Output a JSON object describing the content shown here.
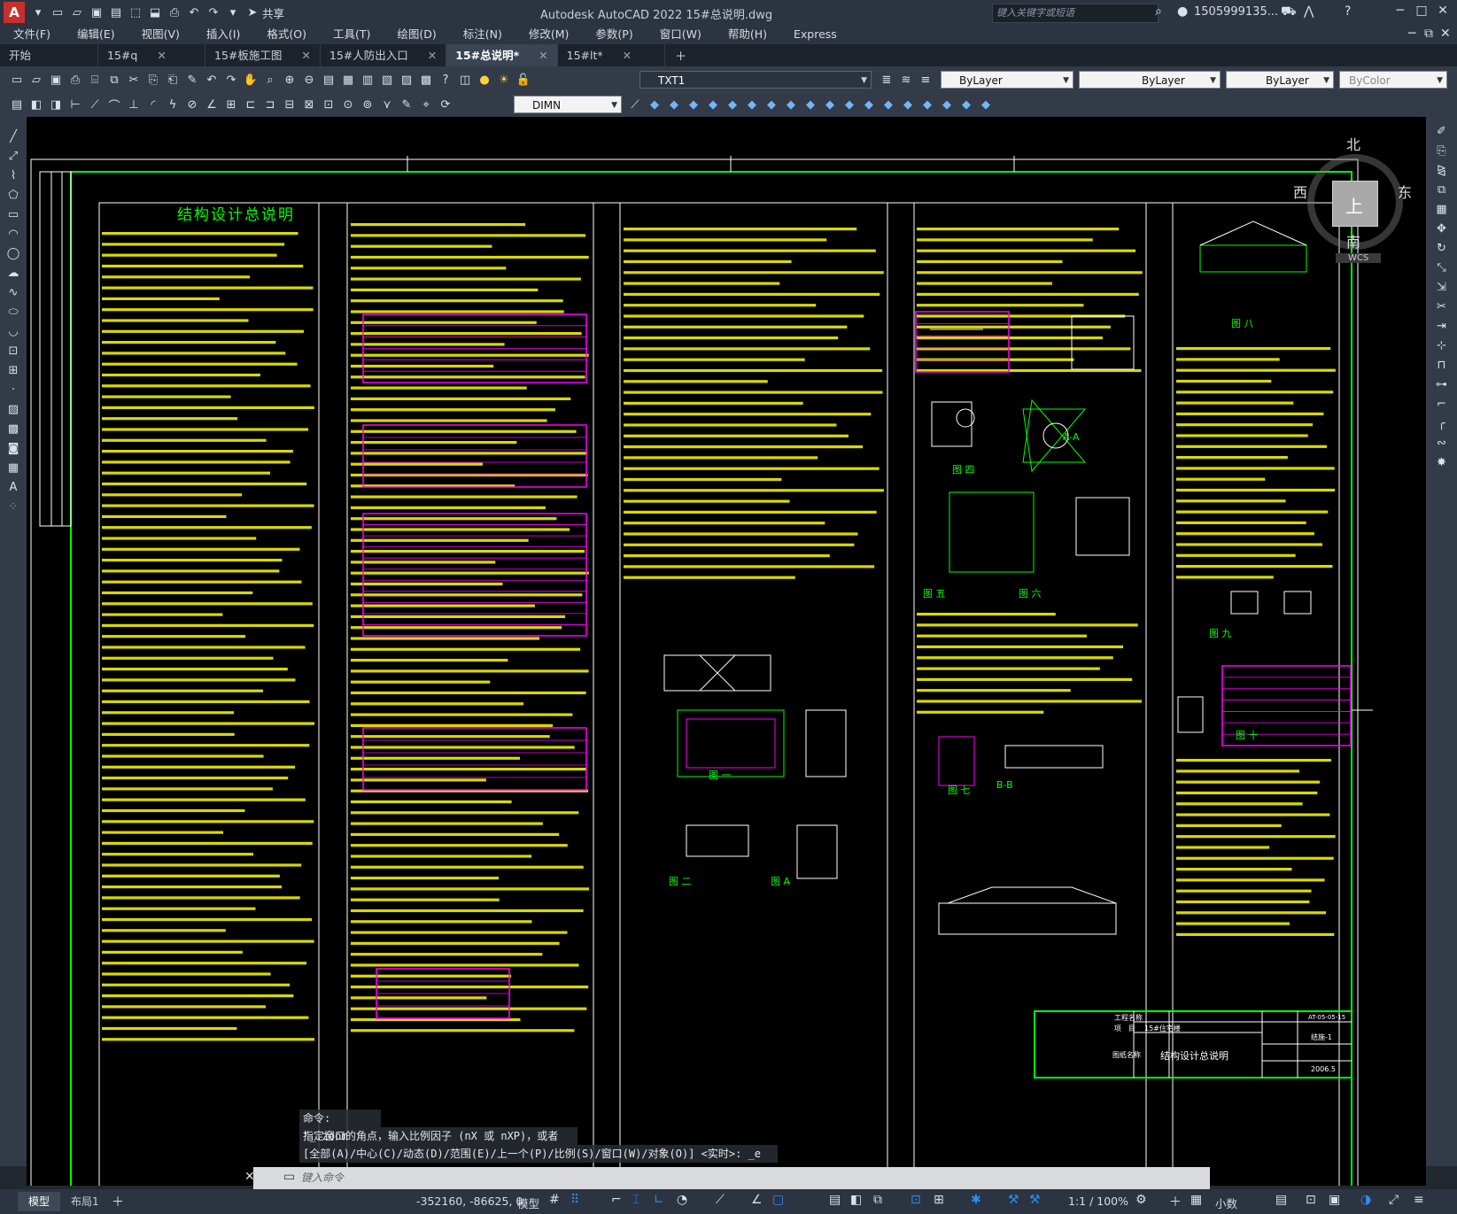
{
  "app": {
    "title": "Autodesk AutoCAD 2022    15#总说明.dwg",
    "share_label": "共享",
    "search_placeholder": "键入关键字或短语",
    "user_name": "1505999135..."
  },
  "menu": [
    "文件(F)",
    "编辑(E)",
    "视图(V)",
    "插入(I)",
    "格式(O)",
    "工具(T)",
    "绘图(D)",
    "标注(N)",
    "修改(M)",
    "参数(P)",
    "窗口(W)",
    "帮助(H)",
    "Express"
  ],
  "tabs": [
    {
      "label": "开始",
      "active": false,
      "closable": false
    },
    {
      "label": "15#q",
      "active": false,
      "closable": true
    },
    {
      "label": "15#板施工图",
      "active": false,
      "closable": true
    },
    {
      "label": "15#人防出入口",
      "active": false,
      "closable": true
    },
    {
      "label": "15#总说明*",
      "active": true,
      "closable": true
    },
    {
      "label": "15#lt*",
      "active": false,
      "closable": true
    }
  ],
  "toolbar": {
    "text_style": "TXT1",
    "layer_color": "ByLayer",
    "linetype": "ByLayer",
    "lineweight": "ByLayer",
    "plot_style": "ByColor",
    "dim_style": "DIMN"
  },
  "viewcube": {
    "north": "北",
    "south": "南",
    "east": "东",
    "west": "西",
    "top": "上",
    "wcs": "WCS"
  },
  "drawing": {
    "main_title": "结构设计总说明",
    "figure_labels": [
      "图 一",
      "图 二",
      "图 A",
      "图 四",
      "图 五",
      "图 六",
      "图 七",
      "B-B",
      "图 八",
      "图 九",
      "图 十",
      "A-A"
    ],
    "title_block": {
      "project_name_label": "工程名称",
      "item_label": "项　目",
      "item_value": "15#住宅楼",
      "drawing_name_label": "图纸名称",
      "drawing_name": "结构设计总说明",
      "sheet_no": "结施-1",
      "date": "2006.5",
      "design_no": "AT-05-05-15"
    }
  },
  "command": {
    "history": [
      "命令: '_.zoom",
      "指定窗口的角点，输入比例因子 (nX 或 nXP)，或者",
      "[全部(A)/中心(C)/动态(D)/范围(E)/上一个(P)/比例(S)/窗口(W)/对象(O)] <实时>: _e"
    ],
    "placeholder": "键入命令"
  },
  "status": {
    "layout_tabs": [
      {
        "label": "模型",
        "active": true
      },
      {
        "label": "布局1",
        "active": false
      }
    ],
    "coords": "-352160, -86625, 0",
    "model_label": "模型",
    "scale": "1:1 / 100%",
    "units": "小数"
  },
  "colors": {
    "drawing_yellow": "#ffff00",
    "frame_green": "#00ff00",
    "table_magenta": "#ff00ff",
    "line_white": "#ffffff",
    "accent_red": "#c6302c"
  }
}
